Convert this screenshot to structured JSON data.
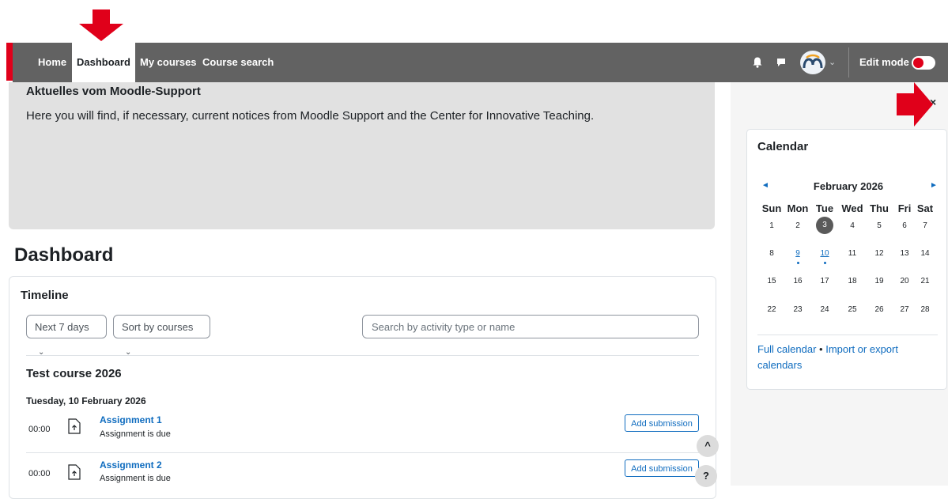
{
  "nav": {
    "items": [
      {
        "label": "Home"
      },
      {
        "label": "Dashboard"
      },
      {
        "label": "My courses"
      },
      {
        "label": "Course search"
      }
    ],
    "edit_mode_label": "Edit mode"
  },
  "notice": {
    "title": "Aktuelles vom Moodle-Support",
    "text": "Here you will find, if necessary, current notices from Moodle Support and the Center for Innovative Teaching."
  },
  "drawer": {
    "close_glyph": "×",
    "calendar": {
      "title": "Calendar",
      "month": "February 2026",
      "prev_glyph": "◄",
      "next_glyph": "►",
      "weekdays": [
        "Sun",
        "Mon",
        "Tue",
        "Wed",
        "Thu",
        "Fri",
        "Sat"
      ],
      "weeks": [
        [
          "1",
          "2",
          "3",
          "4",
          "5",
          "6",
          "7"
        ],
        [
          "8",
          "9",
          "10",
          "11",
          "12",
          "13",
          "14"
        ],
        [
          "15",
          "16",
          "17",
          "18",
          "19",
          "20",
          "21"
        ],
        [
          "22",
          "23",
          "24",
          "25",
          "26",
          "27",
          "28"
        ]
      ],
      "today": "3",
      "event_days": [
        "9",
        "10"
      ],
      "footer_full": "Full calendar",
      "footer_sep": " • ",
      "footer_import": "Import or export calendars"
    }
  },
  "dashboard": {
    "title": "Dashboard",
    "timeline": {
      "title": "Timeline",
      "filter_label": "Next 7 days",
      "sort_label": "Sort by courses",
      "search_placeholder": "Search by activity type or name",
      "course": "Test course 2026",
      "date": "Tuesday, 10 February 2026",
      "items": [
        {
          "time": "00:00",
          "name": "Assignment 1",
          "sub": "Assignment is due",
          "action": "Add submission"
        },
        {
          "time": "00:00",
          "name": "Assignment 2",
          "sub": "Assignment is due",
          "action": "Add submission"
        }
      ]
    }
  },
  "floating": {
    "scroll_up_glyph": "^",
    "help_glyph": "?"
  },
  "colors": {
    "navbar": "#626262",
    "accent": "#0f6cbf",
    "annotation": "#e0001a"
  }
}
